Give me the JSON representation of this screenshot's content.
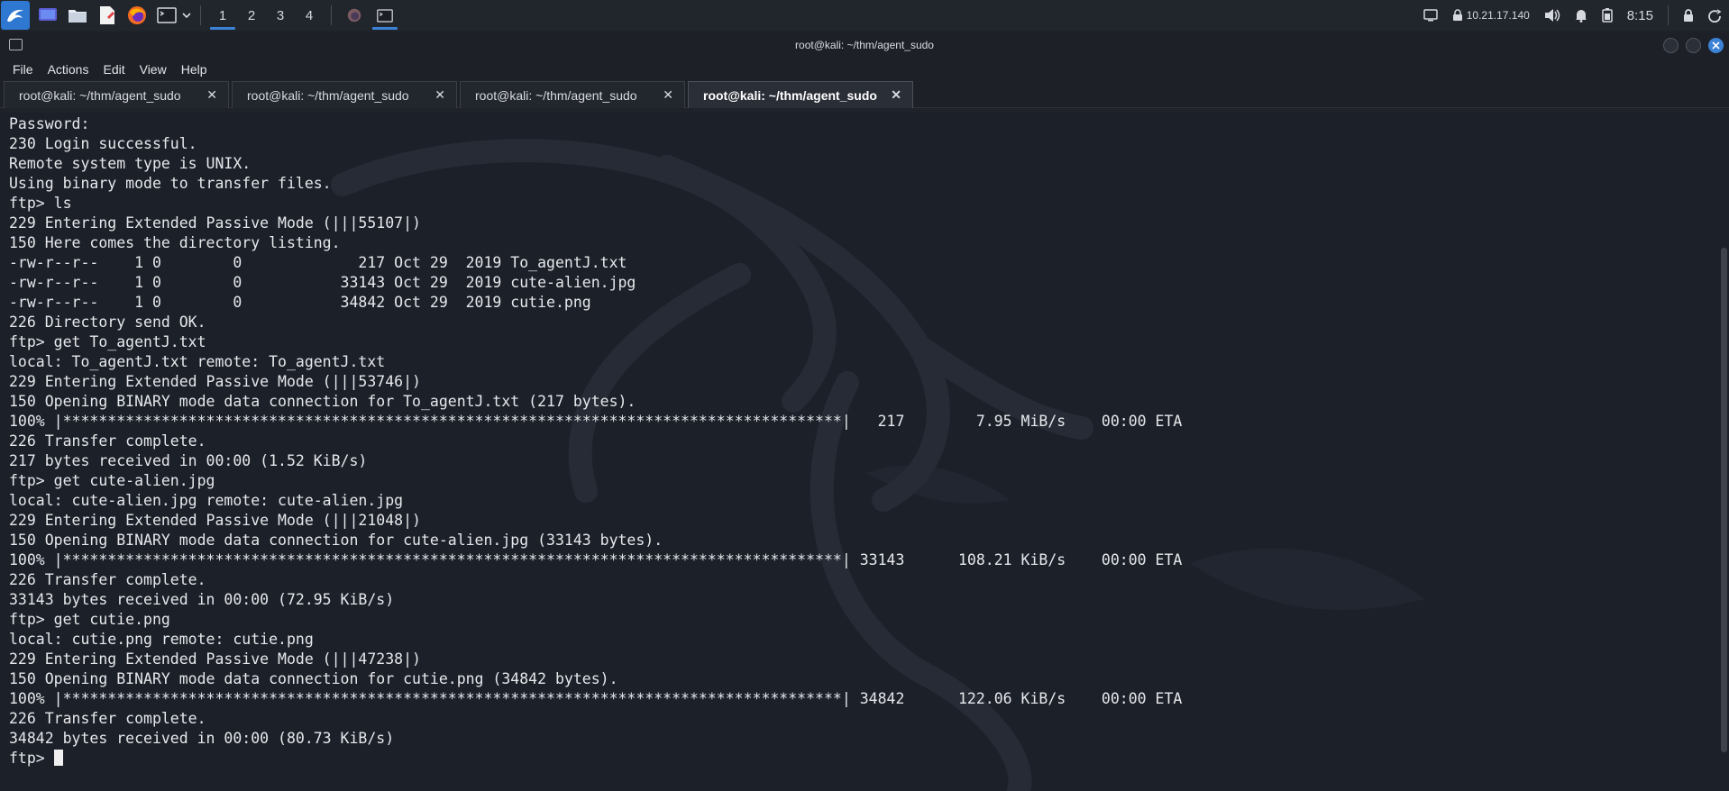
{
  "panel": {
    "workspaces": [
      "1",
      "2",
      "3",
      "4"
    ],
    "active_workspace": "1",
    "tray": {
      "ip": "10.21.17.140",
      "clock": "8:15"
    },
    "launchers": [
      "desktop-icon",
      "file-manager-icon",
      "text-editor-icon",
      "firefox-icon",
      "terminal-icon",
      "chevron-down-icon"
    ]
  },
  "window": {
    "title": "root@kali: ~/thm/agent_sudo"
  },
  "menubar": {
    "items": [
      "File",
      "Actions",
      "Edit",
      "View",
      "Help"
    ]
  },
  "tabs": [
    {
      "label": "root@kali: ~/thm/agent_sudo",
      "active": false
    },
    {
      "label": "root@kali: ~/thm/agent_sudo",
      "active": false
    },
    {
      "label": "root@kali: ~/thm/agent_sudo",
      "active": false
    },
    {
      "label": "root@kali: ~/thm/agent_sudo",
      "active": true
    }
  ],
  "terminal": {
    "lines": [
      "Password:",
      "230 Login successful.",
      "Remote system type is UNIX.",
      "Using binary mode to transfer files.",
      "ftp> ls",
      "229 Entering Extended Passive Mode (|||55107|)",
      "150 Here comes the directory listing.",
      "-rw-r--r--    1 0        0             217 Oct 29  2019 To_agentJ.txt",
      "-rw-r--r--    1 0        0           33143 Oct 29  2019 cute-alien.jpg",
      "-rw-r--r--    1 0        0           34842 Oct 29  2019 cutie.png",
      "226 Directory send OK.",
      "ftp> get To_agentJ.txt",
      "local: To_agentJ.txt remote: To_agentJ.txt",
      "229 Entering Extended Passive Mode (|||53746|)",
      "150 Opening BINARY mode data connection for To_agentJ.txt (217 bytes).",
      "100% |***************************************************************************************|   217        7.95 MiB/s    00:00 ETA",
      "226 Transfer complete.",
      "217 bytes received in 00:00 (1.52 KiB/s)",
      "ftp> get cute-alien.jpg",
      "local: cute-alien.jpg remote: cute-alien.jpg",
      "229 Entering Extended Passive Mode (|||21048|)",
      "150 Opening BINARY mode data connection for cute-alien.jpg (33143 bytes).",
      "100% |***************************************************************************************| 33143      108.21 KiB/s    00:00 ETA",
      "226 Transfer complete.",
      "33143 bytes received in 00:00 (72.95 KiB/s)",
      "ftp> get cutie.png",
      "local: cutie.png remote: cutie.png",
      "229 Entering Extended Passive Mode (|||47238|)",
      "150 Opening BINARY mode data connection for cutie.png (34842 bytes).",
      "100% |***************************************************************************************| 34842      122.06 KiB/s    00:00 ETA",
      "226 Transfer complete.",
      "34842 bytes received in 00:00 (80.73 KiB/s)"
    ],
    "prompt": "ftp> "
  },
  "colors": {
    "accent": "#3b82d6",
    "terminal_bg": "#1c2029",
    "terminal_fg": "#e6e8eb"
  }
}
